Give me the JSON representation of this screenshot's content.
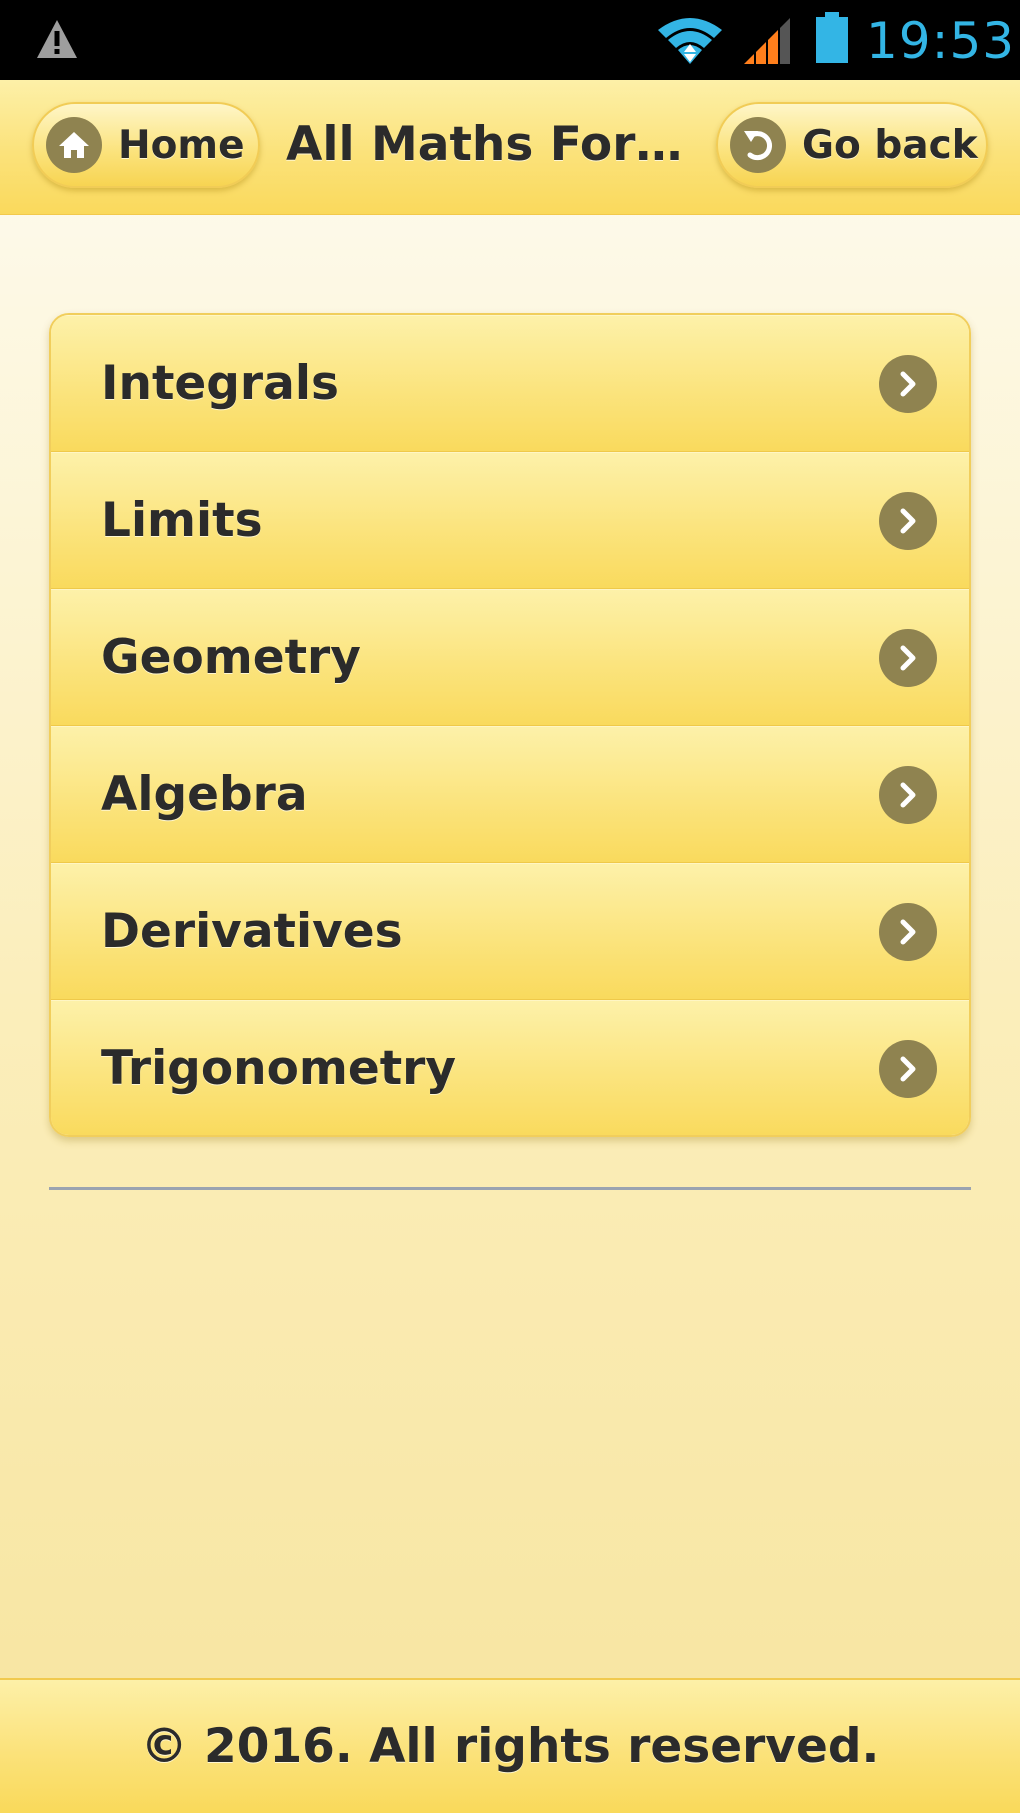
{
  "status_bar": {
    "time": "19:53",
    "icons": [
      "warning-icon",
      "wifi-icon",
      "signal-icon",
      "battery-icon"
    ],
    "clock_color": "#33b5e5"
  },
  "header": {
    "title": "All Maths Formul...",
    "home_label": "Home",
    "home_icon": "home-icon",
    "back_label": "Go back",
    "back_icon": "back-arrow-icon"
  },
  "menu": {
    "items": [
      {
        "label": "Integrals"
      },
      {
        "label": "Limits"
      },
      {
        "label": "Geometry"
      },
      {
        "label": "Algebra"
      },
      {
        "label": "Derivatives"
      },
      {
        "label": "Trigonometry"
      }
    ],
    "item_icon": "chevron-right-icon"
  },
  "footer": {
    "text": "© 2016. All rights reserved."
  },
  "colors": {
    "accent": "#fbe27a",
    "icon_circle": "#8f8350",
    "text": "#2b2b2b"
  }
}
